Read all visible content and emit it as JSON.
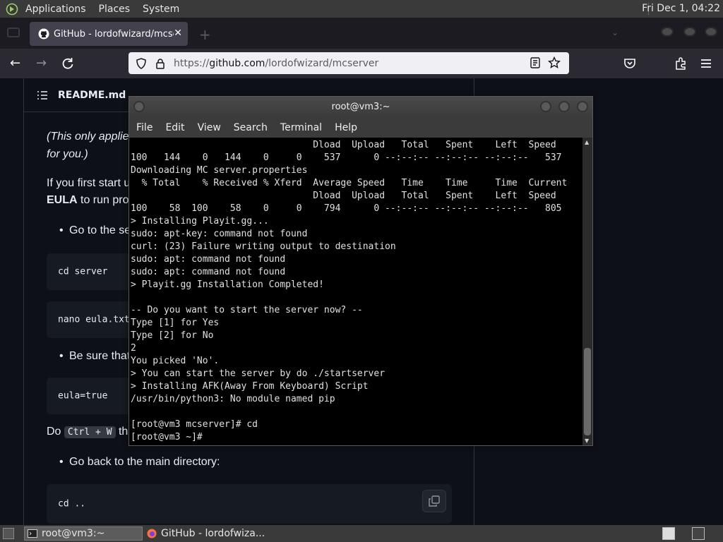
{
  "top_panel": {
    "menus": [
      "Applications",
      "Places",
      "System"
    ],
    "clock": "Fri Dec 1, 04:22"
  },
  "browser": {
    "tab_title": "GitHub - lordofwizard/mcse",
    "url_prefix": "https://",
    "url_domain": "github.com",
    "url_path": "/lordofwizard/mcserver"
  },
  "readme": {
    "header": "README.md",
    "line1": "(This only applie",
    "line2": "for you.)",
    "line3": "If you first start u",
    "line4_bold": "EULA",
    "line4_rest": " to run pro",
    "bullet1": "Go to the se",
    "code1": "cd server",
    "code2": "nano eula.txt",
    "bullet2": "Be sure that",
    "code3": "eula=true",
    "do_text": "Do",
    "kbd": "Ctrl + W",
    "do_rest": "th",
    "bullet3": "Go back to the main directory:",
    "code4": "cd .."
  },
  "terminal": {
    "title": "root@vm3:~",
    "menu": [
      "File",
      "Edit",
      "View",
      "Search",
      "Terminal",
      "Help"
    ],
    "output": "                                 Dload  Upload   Total   Spent    Left  Speed\n100   144    0   144    0     0    537      0 --:--:-- --:--:-- --:--:--   537\nDownloading MC server.properties\n  % Total    % Received % Xferd  Average Speed   Time    Time     Time  Current\n                                 Dload  Upload   Total   Spent    Left  Speed\n100    58  100    58    0     0    794      0 --:--:-- --:--:-- --:--:--   805\n> Installing Playit.gg...\nsudo: apt-key: command not found\ncurl: (23) Failure writing output to destination\nsudo: apt: command not found\nsudo: apt: command not found\n> Playit.gg Installation Completed!\n\n-- Do you want to start the server now? --\nType [1] for Yes\nType [2] for No\n2\nYou picked 'No'.\n> You can start the server by do ./startserver\n> Installing AFK(Away From Keyboard) Script\n/usr/bin/python3: No module named pip\n\n[root@vm3 mcserver]# cd\n[root@vm3 ~]#"
  },
  "taskbar": {
    "tasks": [
      "root@vm3:~",
      "GitHub - lordofwiza..."
    ]
  }
}
